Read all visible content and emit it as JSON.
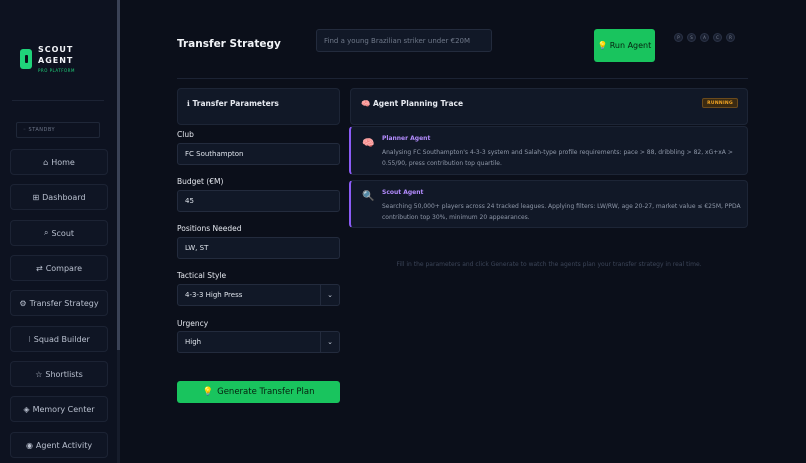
{
  "sidebar": {
    "logo_title": "SCOUT\nAGENT",
    "logo_sub": "PRO PLATFORM",
    "status": "◦ STANDBY",
    "items": [
      {
        "icon": "⌂",
        "label": "Home"
      },
      {
        "icon": "⊞",
        "label": "Dashboard"
      },
      {
        "icon": "⌕",
        "label": "Scout"
      },
      {
        "icon": "⇄",
        "label": "Compare"
      },
      {
        "icon": "⚙",
        "label": "Transfer Strategy"
      },
      {
        "icon": "⁝",
        "label": "Squad Builder"
      },
      {
        "icon": "☆",
        "label": "Shortlists"
      },
      {
        "icon": "◈",
        "label": "Memory Center"
      },
      {
        "icon": "◉",
        "label": "Agent Activity"
      }
    ]
  },
  "header": {
    "title": "Transfer Strategy",
    "search_placeholder": "Find a young Brazilian striker under €20M",
    "run_label": "Run Agent",
    "indicators": [
      "P",
      "S",
      "A",
      "C",
      "R"
    ]
  },
  "params": {
    "title": "Transfer Parameters",
    "club_label": "Club",
    "club_value": "FC Southampton",
    "budget_label": "Budget (€M)",
    "budget_value": "45",
    "positions_label": "Positions Needed",
    "positions_value": "LW, ST",
    "style_label": "Tactical Style",
    "style_value": "4-3-3 High Press",
    "urgency_label": "Urgency",
    "urgency_value": "High",
    "generate_label": "Generate Transfer Plan"
  },
  "trace": {
    "title": "Agent Planning Trace",
    "status": "RUNNING",
    "agents": [
      {
        "name": "Planner Agent",
        "icon": "brain-icon",
        "text": "Analysing FC Southampton's 4-3-3 system and Salah-type profile requirements: pace > 88, dribbling > 82, xG+xA > 0.55/90, press contribution top quartile."
      },
      {
        "name": "Scout Agent",
        "icon": "magnifier-icon",
        "text": "Searching 50,000+ players across 24 tracked leagues. Applying filters: LW/RW, age 20-27, market value ≤ €25M, PPDA contribution top 30%, minimum 20 appearances."
      }
    ],
    "empty_message": "Fill in the parameters and click Generate to watch the agents plan your transfer strategy in real time."
  },
  "colors": {
    "accent": "#19c45e",
    "agent_accent": "#8b5cf6",
    "running": "#f5a623"
  }
}
